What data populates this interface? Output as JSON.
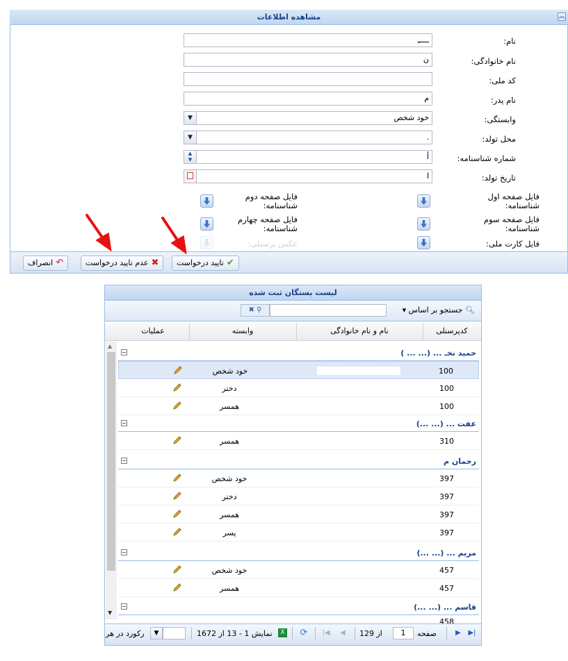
{
  "form_panel": {
    "title": "مشاهده اطلاعات",
    "fields": [
      {
        "label": "نام:",
        "value": "ـــــِ"
      },
      {
        "label": "نام خانوادگی:",
        "value": "ن"
      },
      {
        "label": "کد ملی:",
        "value": ""
      },
      {
        "label": "نام پدر:",
        "value": "م"
      },
      {
        "label": "وابستگی:",
        "value": "خود شخص"
      },
      {
        "label": "محل تولد:",
        "value": "."
      },
      {
        "label": "شماره شناسنامه:",
        "value": "أ"
      },
      {
        "label": "تاریخ تولد:",
        "value": "ا"
      }
    ],
    "uploads": {
      "page1": "فایل صفحه اول شناسنامه:",
      "page2": "فایل صفحه دوم شناسنامه:",
      "page3": "فایل صفحه سوم شناسنامه:",
      "page4": "فایل صفحه چهارم شناسنامه:",
      "national_card": "فایل کارت ملی:",
      "personal_photo": "عکس پرسنلی:"
    },
    "buttons": {
      "approve": "تایید درخواست",
      "reject": "عدم تایید درخواست",
      "cancel": "انصراف"
    }
  },
  "grid_panel": {
    "title": "لیست بستگان ثبت شده",
    "search_by": "جستجو بر اساس",
    "columns": {
      "code": "کدپرسنلی",
      "name": "نام و نام خانوادگی",
      "dependency": "وابسته",
      "operations": "عملیات"
    },
    "groups": [
      {
        "title": "حمید نخـ ... (... ... )",
        "rows": [
          {
            "code": "100",
            "dependency": "خود شخص"
          },
          {
            "code": "100",
            "dependency": "دختر"
          },
          {
            "code": "100",
            "dependency": "همسر"
          }
        ]
      },
      {
        "title": "عفت ... (... ...)",
        "rows": [
          {
            "code": "310",
            "dependency": "همسر"
          }
        ]
      },
      {
        "title": "رحمان م",
        "rows": [
          {
            "code": "397",
            "dependency": "خود شخص"
          },
          {
            "code": "397",
            "dependency": "دختر"
          },
          {
            "code": "397",
            "dependency": "همسر"
          },
          {
            "code": "397",
            "dependency": "پسر"
          }
        ]
      },
      {
        "title": "مریم ... (... ...)",
        "rows": [
          {
            "code": "457",
            "dependency": "خود شخص"
          },
          {
            "code": "457",
            "dependency": "همسر"
          }
        ]
      },
      {
        "title": "قاسم ... (... ...)",
        "rows": []
      }
    ],
    "pager": {
      "page_label": "صفحه",
      "page": "1",
      "of_pages": "از 129",
      "display_text": "نمایش 1 - 13 از 1672",
      "records_per_label": "رکورد در هر",
      "partial_row_code": "458"
    }
  },
  "colors": {
    "header_text": "#15428b",
    "border": "#99bbe8",
    "arrow": "#e8110f"
  }
}
